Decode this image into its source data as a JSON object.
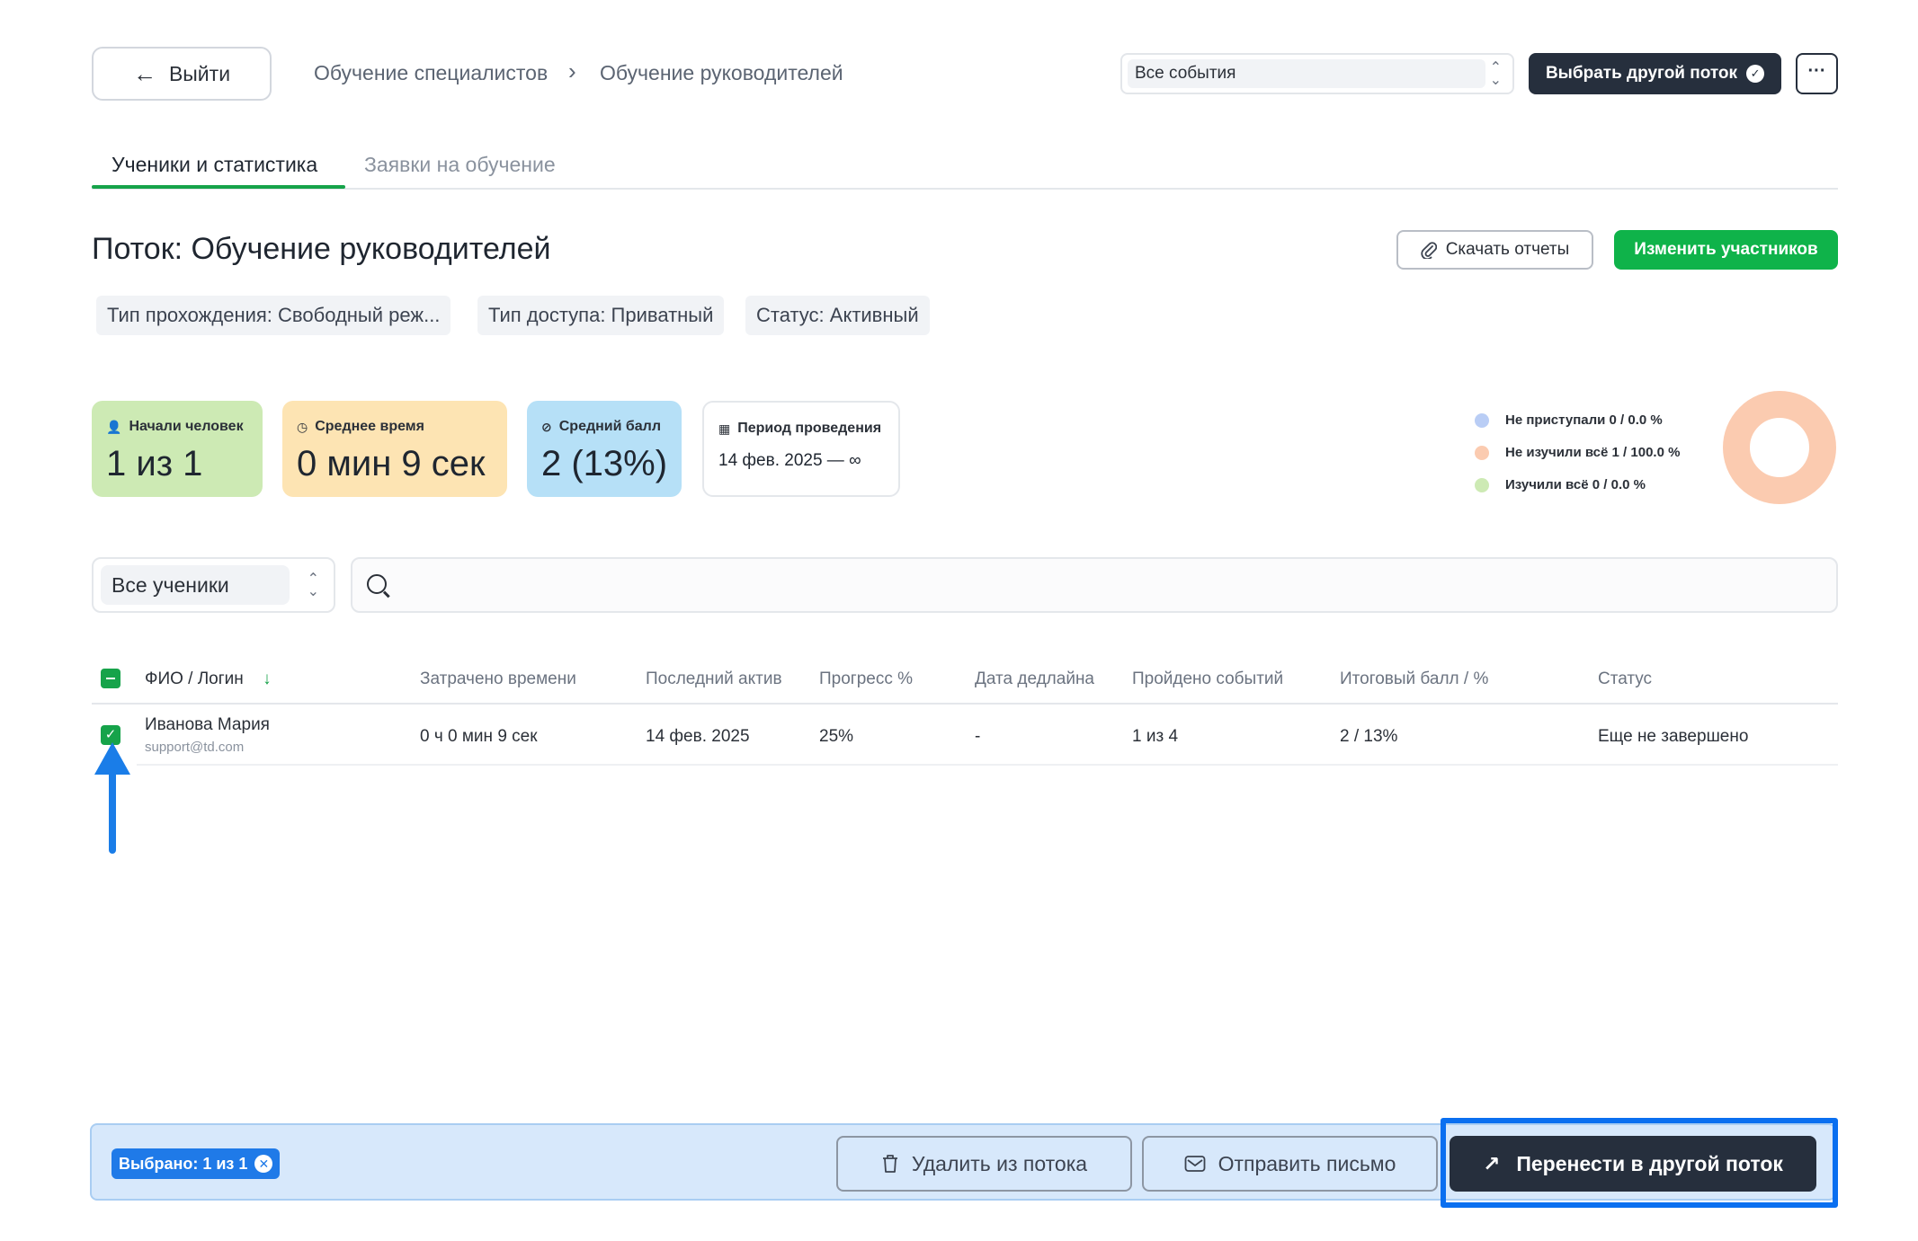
{
  "header": {
    "exit_label": "Выйти",
    "breadcrumb": [
      "Обучение специалистов",
      "Обучение руководителей"
    ],
    "events_select": "Все события",
    "choose_stream_label": "Выбрать другой поток",
    "more_label": "···"
  },
  "tabs": [
    {
      "label": "Ученики и статистика",
      "active": true
    },
    {
      "label": "Заявки на обучение",
      "active": false
    }
  ],
  "page": {
    "title": "Поток: Обучение руководителей",
    "download_label": "Скачать отчеты",
    "edit_participants_label": "Изменить участников",
    "tags": [
      "Тип прохождения: Свободный реж...",
      "Тип доступа: Приватный",
      "Статус: Активный"
    ]
  },
  "stats": {
    "started": {
      "label": "Начали человек",
      "value": "1 из 1"
    },
    "avg_time": {
      "label": "Среднее время",
      "value": "0 мин 9 сек"
    },
    "avg_score": {
      "label": "Средний балл",
      "value": "2 (13%)"
    },
    "period": {
      "label": "Период проведения",
      "value": "14 фев. 2025 — ∞"
    }
  },
  "legend": [
    {
      "label": "Не приступали 0 / 0.0 %",
      "color": "#b9cdf5"
    },
    {
      "label": "Не изучили всё 1 / 100.0 %",
      "color": "#fbcbb0"
    },
    {
      "label": "Изучили всё 0 / 0.0 %",
      "color": "#cdeab4"
    }
  ],
  "donut": {
    "segments": [
      0,
      100,
      0
    ],
    "colors": [
      "#b9cdf5",
      "#fbcbb0",
      "#cdeab4"
    ]
  },
  "filters": {
    "students_select": "Все ученики",
    "search_placeholder": ""
  },
  "table": {
    "columns": [
      "ФИО / Логин",
      "Затрачено времени",
      "Последний актив",
      "Прогресс %",
      "Дата дедлайна",
      "Пройдено событий",
      "Итоговый балл / %",
      "Статус"
    ],
    "rows": [
      {
        "name": "Иванова Мария",
        "login": "support@td.com",
        "time_spent": "0 ч 0 мин 9 сек",
        "last_active": "14 фев. 2025",
        "progress": "25%",
        "deadline": "-",
        "events_passed": "1 из 4",
        "score": "2 / 13%",
        "status": "Еще не завершено",
        "checked": true
      }
    ]
  },
  "bottom_bar": {
    "selected_label": "Выбрано: 1 из 1",
    "delete_label": "Удалить из потока",
    "send_label": "Отправить письмо",
    "transfer_label": "Перенести в другой поток"
  },
  "colors": {
    "accent_green": "#16a34a",
    "dark": "#262f3d",
    "highlight_blue": "#0a6ff0"
  }
}
